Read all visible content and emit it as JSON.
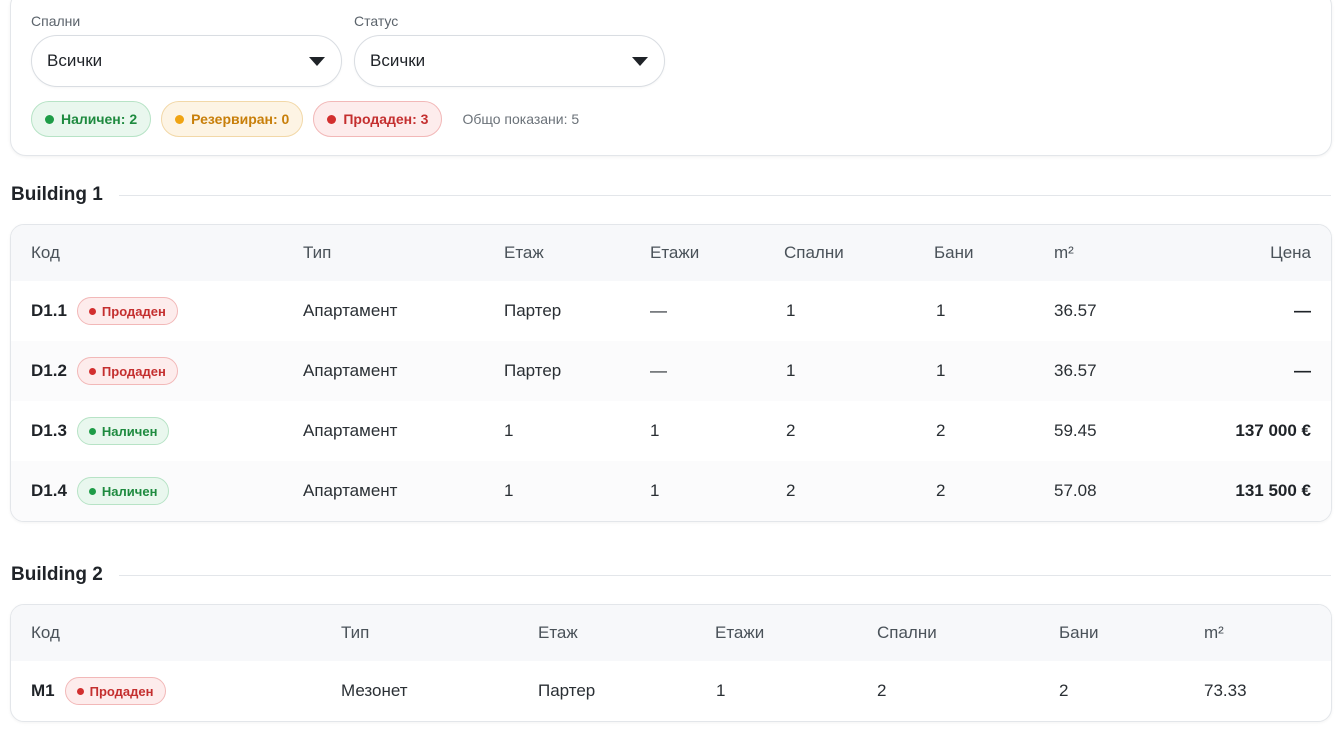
{
  "filters": {
    "bedrooms": {
      "label": "Спални",
      "value": "Всички"
    },
    "status": {
      "label": "Статус",
      "value": "Всички"
    }
  },
  "summary": {
    "available": "Наличен: 2",
    "reserved": "Резервиран: 0",
    "sold": "Продаден: 3",
    "total": "Общо показани: 5"
  },
  "status_colors": {
    "available": "#1e9c47",
    "reserved": "#f0a413",
    "sold": "#d22f2f"
  },
  "buildings": [
    {
      "title": "Building 1",
      "headers": {
        "code": "Код",
        "type": "Тип",
        "floor": "Етаж",
        "floors": "Етажи",
        "bedrooms": "Спални",
        "baths": "Бани",
        "area": "m²",
        "price": "Цена"
      },
      "rows": [
        {
          "code": "D1.1",
          "status": "Продаден",
          "type": "Апартамент",
          "floor": "Партер",
          "floors": "—",
          "bedrooms": "1",
          "baths": "1",
          "area": "36.57",
          "price": "—"
        },
        {
          "code": "D1.2",
          "status": "Продаден",
          "type": "Апартамент",
          "floor": "Партер",
          "floors": "—",
          "bedrooms": "1",
          "baths": "1",
          "area": "36.57",
          "price": "—"
        },
        {
          "code": "D1.3",
          "status": "Наличен",
          "type": "Апартамент",
          "floor": "1",
          "floors": "1",
          "bedrooms": "2",
          "baths": "2",
          "area": "59.45",
          "price": "137 000 €"
        },
        {
          "code": "D1.4",
          "status": "Наличен",
          "type": "Апартамент",
          "floor": "1",
          "floors": "1",
          "bedrooms": "2",
          "baths": "2",
          "area": "57.08",
          "price": "131 500 €"
        }
      ]
    },
    {
      "title": "Building 2",
      "headers": {
        "code": "Код",
        "type": "Тип",
        "floor": "Етаж",
        "floors": "Етажи",
        "bedrooms": "Спални",
        "baths": "Бани",
        "area": "m²"
      },
      "rows": [
        {
          "code": "M1",
          "status": "Продаден",
          "type": "Мезонет",
          "floor": "Партер",
          "floors": "1",
          "bedrooms": "2",
          "baths": "2",
          "area": "73.33"
        }
      ]
    }
  ]
}
